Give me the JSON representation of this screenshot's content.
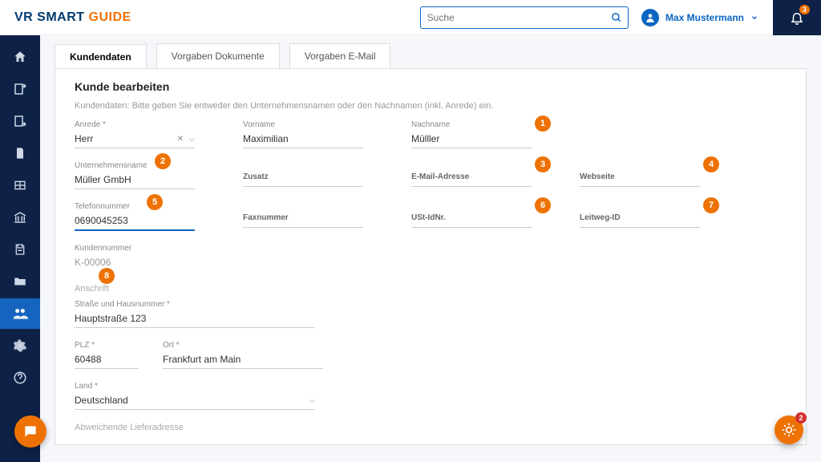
{
  "brand": {
    "part1": "VR SMART ",
    "part2": "GUIDE"
  },
  "search": {
    "placeholder": "Suche"
  },
  "user": {
    "name": "Max Mustermann"
  },
  "notifications": {
    "count": "3"
  },
  "tabs": [
    {
      "label": "Kundendaten",
      "active": true
    },
    {
      "label": "Vorgaben Dokumente",
      "active": false
    },
    {
      "label": "Vorgaben E-Mail",
      "active": false
    }
  ],
  "page": {
    "title": "Kunde bearbeiten",
    "hint": "Kundendaten: Bitte geben Sie entweder den Unternehmensnamen oder den Nachnamen (inkl. Anrede) ein."
  },
  "fields": {
    "anrede_label": "Anrede *",
    "anrede_value": "Herr",
    "vorname_label": "Vorname",
    "vorname_value": "Maximilian",
    "nachname_label": "Nachname",
    "nachname_value": "Mülller",
    "unternehmen_label": "Unternehmensname",
    "unternehmen_value": "Müller GmbH",
    "zusatz_label": "Zusatz",
    "zusatz_value": "",
    "email_label": "E-Mail-Adresse",
    "email_value": "",
    "webseite_label": "Webseite",
    "webseite_value": "",
    "telefon_label": "Telefonnummer",
    "telefon_value": "0690045253",
    "fax_label": "Faxnummer",
    "fax_value": "",
    "ust_label": "USt-IdNr.",
    "ust_value": "",
    "leitweg_label": "Leitweg-ID",
    "leitweg_value": "",
    "kundennr_label": "Kundennummer",
    "kundennr_value": "K-00006",
    "anschrift_label": "Anschrift",
    "strasse_label": "Straße und Hausnummer *",
    "strasse_value": "Hauptstraße 123",
    "plz_label": "PLZ *",
    "plz_value": "60488",
    "ort_label": "Ort *",
    "ort_value": "Frankfurt am Main",
    "land_label": "Land *",
    "land_value": "Deutschland",
    "liefer_label": "Abweichende Lieferadresse"
  },
  "callouts": [
    "1",
    "2",
    "3",
    "4",
    "5",
    "6",
    "7",
    "8"
  ],
  "help_badge": "2"
}
